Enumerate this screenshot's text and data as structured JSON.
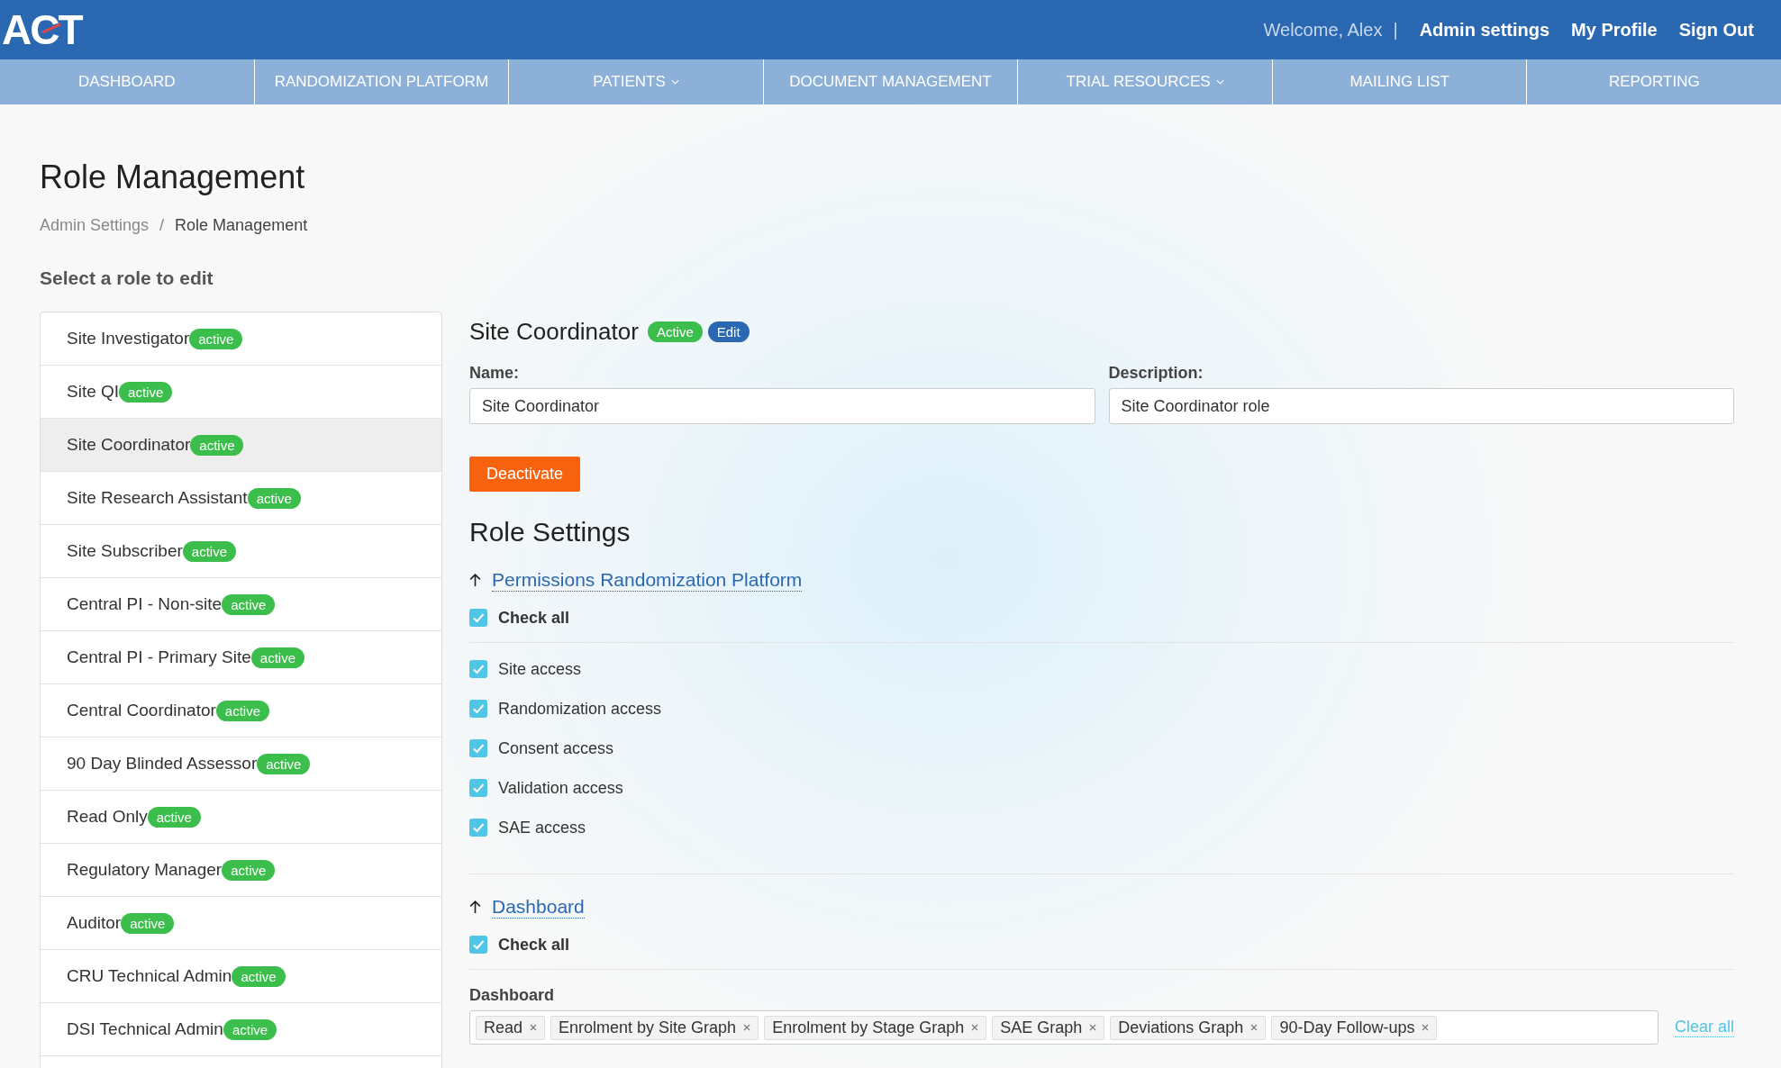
{
  "header": {
    "logo": "ACT",
    "welcome": "Welcome, Alex",
    "separator": "|",
    "links": [
      "Admin settings",
      "My Profile",
      "Sign Out"
    ]
  },
  "nav": [
    {
      "label": "DASHBOARD",
      "dropdown": false
    },
    {
      "label": "RANDOMIZATION PLATFORM",
      "dropdown": false
    },
    {
      "label": "PATIENTS",
      "dropdown": true
    },
    {
      "label": "DOCUMENT MANAGEMENT",
      "dropdown": false
    },
    {
      "label": "TRIAL RESOURCES",
      "dropdown": true
    },
    {
      "label": "MAILING LIST",
      "dropdown": false
    },
    {
      "label": "REPORTING",
      "dropdown": false
    }
  ],
  "page_title": "Role Management",
  "breadcrumb": [
    "Admin Settings",
    "/",
    "Role Management"
  ],
  "roles_heading": "Select a role to edit",
  "roles": [
    {
      "name": "Site Investigator",
      "badge": "active",
      "selected": false
    },
    {
      "name": "Site QI",
      "badge": "active",
      "selected": false
    },
    {
      "name": "Site Coordinator",
      "badge": "active",
      "selected": true
    },
    {
      "name": "Site Research Assistant",
      "badge": "active",
      "selected": false
    },
    {
      "name": "Site Subscriber",
      "badge": "active",
      "selected": false
    },
    {
      "name": "Central PI - Non-site",
      "badge": "active",
      "selected": false
    },
    {
      "name": "Central PI - Primary Site",
      "badge": "active",
      "selected": false
    },
    {
      "name": "Central Coordinator",
      "badge": "active",
      "selected": false
    },
    {
      "name": "90 Day Blinded Assessor",
      "badge": "active",
      "selected": false
    },
    {
      "name": "Read Only",
      "badge": "active",
      "selected": false
    },
    {
      "name": "Regulatory Manager",
      "badge": "active",
      "selected": false
    },
    {
      "name": "Auditor",
      "badge": "active",
      "selected": false
    },
    {
      "name": "CRU Technical Admin",
      "badge": "active",
      "selected": false
    },
    {
      "name": "DSI Technical Admin",
      "badge": "active",
      "selected": false
    }
  ],
  "editor": {
    "title": "Site Coordinator",
    "status": "Active",
    "edit": "Edit",
    "name_label": "Name:",
    "name_value": "Site Coordinator",
    "description_label": "Description:",
    "description_value": "Site Coordinator role",
    "deactivate": "Deactivate",
    "settings_heading": "Role Settings",
    "sections": [
      {
        "title": "Permissions Randomization Platform",
        "expanded": true,
        "check_all": {
          "label": "Check all",
          "checked": true
        },
        "permissions": [
          {
            "label": "Site access",
            "checked": true
          },
          {
            "label": "Randomization access",
            "checked": true
          },
          {
            "label": "Consent access",
            "checked": true
          },
          {
            "label": "Validation access",
            "checked": true
          },
          {
            "label": "SAE access",
            "checked": true
          }
        ]
      },
      {
        "title": "Dashboard",
        "expanded": true,
        "check_all": {
          "label": "Check all",
          "checked": true
        },
        "field_label": "Dashboard",
        "tags": [
          "Read",
          "Enrolment by Site Graph",
          "Enrolment by Stage Graph",
          "SAE Graph",
          "Deviations Graph",
          "90-Day Follow-ups"
        ],
        "clear": "Clear all"
      }
    ]
  }
}
